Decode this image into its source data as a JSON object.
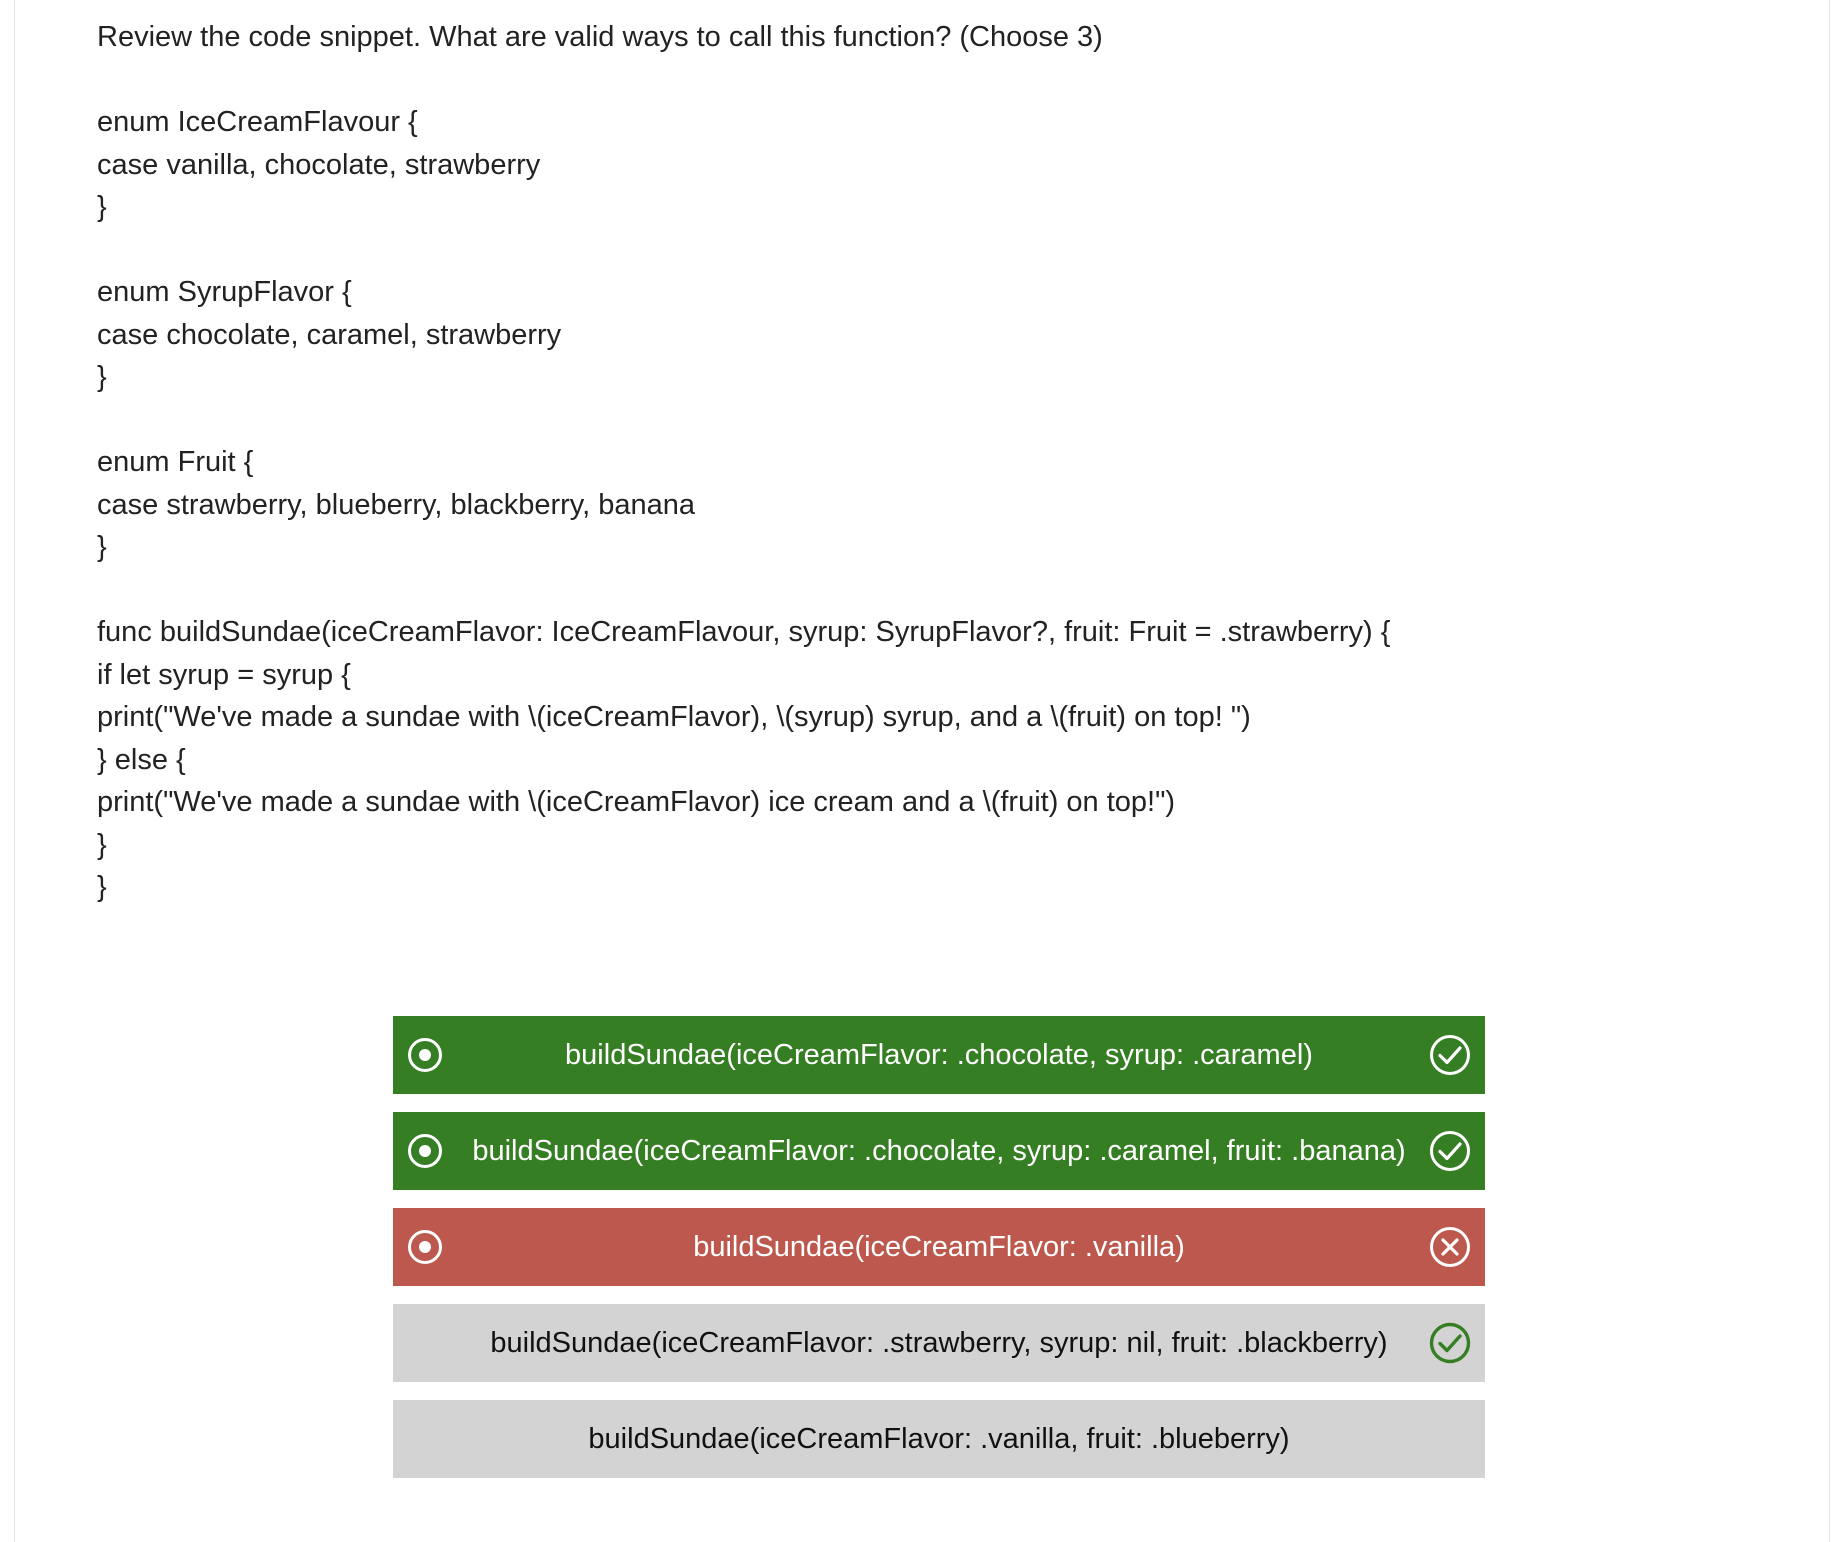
{
  "question": {
    "lines": [
      "Review the code snippet. What are valid ways to call this function? (Choose 3)",
      "",
      "enum IceCreamFlavour {",
      "case vanilla, chocolate, strawberry",
      "}",
      "",
      "enum SyrupFlavor {",
      "case chocolate, caramel, strawberry",
      "}",
      "",
      "enum Fruit {",
      "case strawberry, blueberry, blackberry, banana",
      "}",
      "",
      "func buildSundae(iceCreamFlavor: IceCreamFlavour, syrup: SyrupFlavor?, fruit: Fruit = .strawberry) {",
      "if let syrup = syrup {",
      "print(\"We've made a sundae with \\(iceCreamFlavor), \\(syrup) syrup, and a \\(fruit) on top! \")",
      "} else {",
      "print(\"We've made a sundae with \\(iceCreamFlavor) ice cream and a \\(fruit) on top!\")",
      "}",
      "}"
    ]
  },
  "answers": [
    {
      "label": "buildSundae(iceCreamFlavor: .chocolate, syrup: .caramel)",
      "selected": true,
      "status": "correct-selected",
      "result_icon": "check-circle-icon"
    },
    {
      "label": "buildSundae(iceCreamFlavor: .chocolate, syrup: .caramel, fruit: .banana)",
      "selected": true,
      "status": "correct-selected",
      "result_icon": "check-circle-icon"
    },
    {
      "label": "buildSundae(iceCreamFlavor: .vanilla)",
      "selected": true,
      "status": "wrong-selected",
      "result_icon": "x-circle-icon"
    },
    {
      "label": "buildSundae(iceCreamFlavor: .strawberry, syrup: nil, fruit: .blackberry)",
      "selected": false,
      "status": "unselected",
      "result_icon": "check-circle-icon"
    },
    {
      "label": "buildSundae(iceCreamFlavor: .vanilla, fruit: .blueberry)",
      "selected": false,
      "status": "unselected",
      "result_icon": ""
    }
  ],
  "colors": {
    "correct": "#367e23",
    "wrong": "#bc584d",
    "neutral": "#d3d3d3",
    "missed_check": "#367e23"
  }
}
